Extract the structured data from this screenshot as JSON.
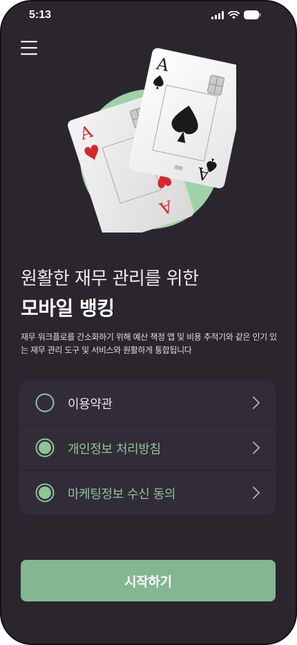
{
  "status_bar": {
    "time": "5:13",
    "icons": [
      "signal-icon",
      "wifi-icon",
      "battery-icon"
    ]
  },
  "menu": {
    "icon": "hamburger-menu-icon"
  },
  "hero": {
    "front_card_rank": "A",
    "back_card_rank": "A",
    "front_card_suit": "spade",
    "back_card_suit": "heart"
  },
  "headline": {
    "line1": "원활한 재무 관리를 위한",
    "line2": "모바일 뱅킹"
  },
  "description": "재무 워크플로를 간소화하기 위해 예산 책정 앱 및 비용 추적기와 같은 인기 있는 재무 관리 도구 및 서비스와 원활하게 통합됩니다",
  "agreements": [
    {
      "label": "이용약관",
      "checked": false
    },
    {
      "label": "개인정보 처리방침",
      "checked": true
    },
    {
      "label": "마케팅정보 수신 동의",
      "checked": true
    }
  ],
  "start_button": {
    "label": "시작하기"
  },
  "colors": {
    "background": "#2b262e",
    "card_surface": "#322c38",
    "accent_green": "#83b693",
    "hero_circle": "#9fd2a6"
  }
}
